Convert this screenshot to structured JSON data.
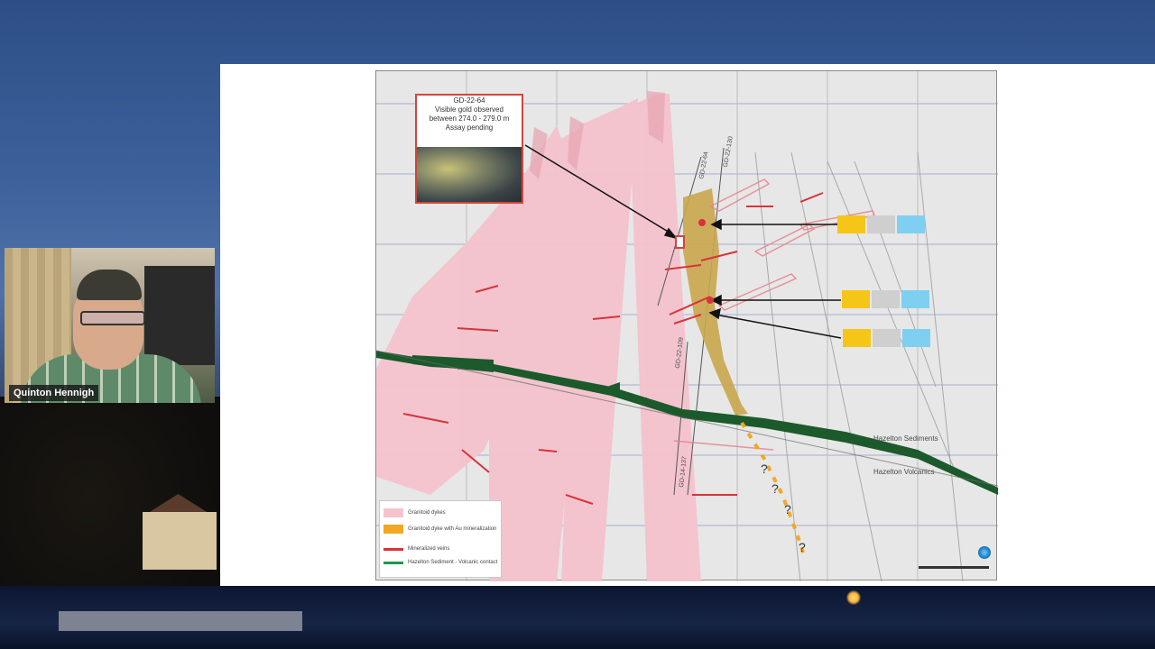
{
  "webcam": {
    "participant_name": "Quinton Hennigh"
  },
  "slide": {
    "callout": {
      "hole_id": "GD-22-64",
      "line1": "Visible gold observed",
      "line2": "between 274.0 - 279.0 m",
      "line3": "Assay pending"
    },
    "drillholes": [
      "GD-22-64",
      "GD-22-130",
      "GD-22-109",
      "GD-14-137"
    ],
    "units": {
      "upper": "Hazelton Sediments",
      "lower": "Hazelton Volcanics"
    },
    "legend": [
      {
        "label": "Granitoid dykes",
        "color": "#f4c3cd",
        "kind": "swatch"
      },
      {
        "label": "Granitoid dyke with Au mineralization",
        "color": "#f2a822",
        "kind": "swatch"
      },
      {
        "label": "Mineralized veins",
        "color": "#d8333a",
        "kind": "line"
      },
      {
        "label": "Hazelton Sediment - Volcanic contact",
        "color": "#169a4a",
        "kind": "line"
      }
    ],
    "colors": {
      "dyke_pink": "#f4c3cd",
      "au_dyke": "#c9a64d",
      "vein_red": "#d8333a",
      "contact_green": "#1c5a2c"
    },
    "unreadable_question_marks": "?"
  }
}
